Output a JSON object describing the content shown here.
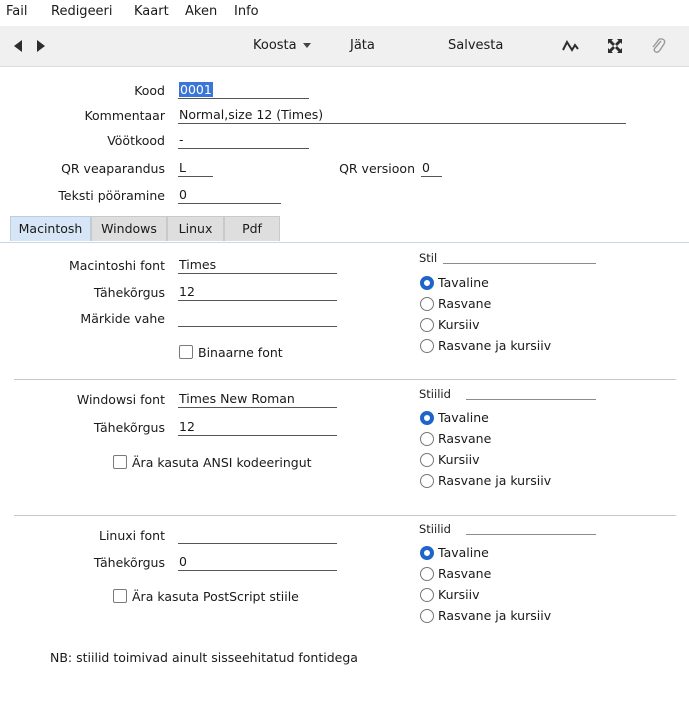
{
  "menu": [
    "Fail",
    "Redigeeri",
    "Kaart",
    "Aken",
    "Info"
  ],
  "toolbar": {
    "prev_icon": "arrow-left",
    "next_icon": "arrow-right",
    "koosta": "Koosta",
    "jata": "Jäta",
    "salvesta": "Salvesta",
    "icons": [
      "activity-icon",
      "expand-icon",
      "paperclip-icon"
    ]
  },
  "header": {
    "kood_label": "Kood",
    "kood_value": "0001",
    "kommentaar_label": "Kommentaar",
    "kommentaar_value": "Normal,size 12 (Times)",
    "vootkood_label": "Vöötkood",
    "vootkood_value": "-",
    "qr_veaparandus_label": "QR veaparandus",
    "qr_veaparandus_value": "L",
    "qr_versioon_label": "QR versioon",
    "qr_versioon_value": "0",
    "teksti_label": "Teksti pööramine",
    "teksti_value": "0"
  },
  "tabs": [
    "Macintosh",
    "Windows",
    "Linux",
    "Pdf"
  ],
  "active_tab": "Macintosh",
  "mac": {
    "font_label": "Macintoshi font",
    "font_value": "Times",
    "size_label": "Tähekõrgus",
    "size_value": "12",
    "spacing_label": "Märkide vahe",
    "spacing_value": "",
    "binary_label": "Binaarne font",
    "binary_checked": false,
    "stil_label": "Stil",
    "styles": [
      "Tavaline",
      "Rasvane",
      "Kursiiv",
      "Rasvane ja kursiiv"
    ],
    "selected_style": 0
  },
  "windows": {
    "font_label": "Windowsi font",
    "font_value": "Times New Roman",
    "size_label": "Tähekõrgus",
    "size_value": "12",
    "ansi_label": "Ära kasuta ANSI kodeeringut",
    "ansi_checked": false,
    "stil_label": "Stiilid",
    "styles": [
      "Tavaline",
      "Rasvane",
      "Kursiiv",
      "Rasvane ja kursiiv"
    ],
    "selected_style": 0
  },
  "linux": {
    "font_label": "Linuxi font",
    "font_value": "",
    "size_label": "Tähekõrgus",
    "size_value": "0",
    "postscript_label": "Ära kasuta PostScript stiile",
    "postscript_checked": false,
    "stil_label": "Stiilid",
    "styles": [
      "Tavaline",
      "Rasvane",
      "Kursiiv",
      "Rasvane ja kursiiv"
    ],
    "selected_style": 0
  },
  "note": "NB: stiilid toimivad ainult sisseehitatud fontidega",
  "colors": {
    "accent": "#1f65c9",
    "selection": "#3a75d8",
    "tab_active": "#d6e6f6",
    "toolbar_bg": "#f0f0f0"
  }
}
